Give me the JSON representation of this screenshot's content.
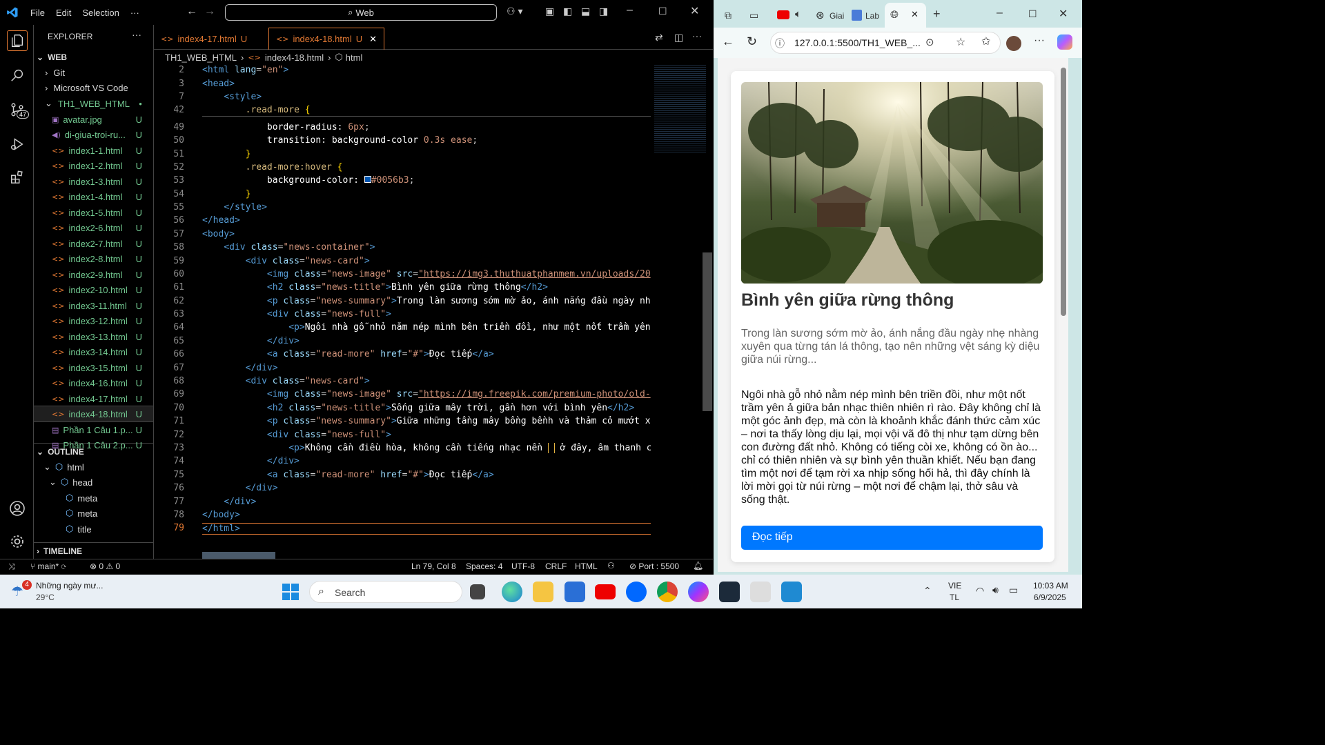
{
  "vscode": {
    "menu": [
      "File",
      "Edit",
      "Selection"
    ],
    "search": "Web",
    "tabs": [
      {
        "label": "index4-17.html",
        "status": "U"
      },
      {
        "label": "index4-18.html",
        "status": "U"
      }
    ],
    "breadcrumb": [
      "TH1_WEB_HTML",
      "index4-18.html",
      "html"
    ],
    "explorer_title": "EXPLORER",
    "section_web": "WEB",
    "folders": [
      "Git",
      "Microsoft VS Code",
      "TH1_WEB_HTML"
    ],
    "files": [
      "avatar.jpg",
      "di-giua-troi-ru...",
      "index1-1.html",
      "index1-2.html",
      "index1-3.html",
      "index1-4.html",
      "index1-5.html",
      "index2-6.html",
      "index2-7.html",
      "index2-8.html",
      "index2-9.html",
      "index2-10.html",
      "index3-11.html",
      "index3-12.html",
      "index3-13.html",
      "index3-14.html",
      "index3-15.html",
      "index4-16.html",
      "index4-17.html",
      "index4-18.html",
      "Phần 1 Câu 1.p...",
      "Phần 1 Câu 2.p..."
    ],
    "file_status": "U",
    "outline_title": "OUTLINE",
    "outline": [
      "html",
      "head",
      "meta",
      "meta",
      "title"
    ],
    "timeline_title": "TIMELINE",
    "scm_badge": "47",
    "line_numbers": [
      "2",
      "3",
      "7",
      "42",
      "49",
      "50",
      "51",
      "52",
      "53",
      "54",
      "55",
      "56",
      "57",
      "58",
      "59",
      "60",
      "61",
      "62",
      "63",
      "64",
      "65",
      "66",
      "67",
      "68",
      "69",
      "70",
      "71",
      "72",
      "73",
      "74",
      "75",
      "76",
      "77",
      "78",
      "79"
    ],
    "status": {
      "branch": "main*",
      "errors": "0",
      "warnings": "0",
      "position": "Ln 79, Col 8",
      "spaces": "Spaces: 4",
      "encoding": "UTF-8",
      "eol": "CRLF",
      "language": "HTML",
      "port": "Port : 5500"
    }
  },
  "browser": {
    "tabs": [
      "Giai",
      "Lab"
    ],
    "url": "127.0.0.1:5500/TH1_WEB_...",
    "page": {
      "title": "Bình yên giữa rừng thông",
      "summary": "Trong làn sương sớm mờ ảo, ánh nắng đầu ngày nhẹ nhàng xuyên qua từng tán lá thông, tạo nên những vệt sáng kỳ diệu giữa núi rừng...",
      "full": "Ngôi nhà gỗ nhỏ nằm nép mình bên triền đồi, như một nốt trầm yên ả giữa bản nhạc thiên nhiên rì rào. Đây không chỉ là một góc ảnh đẹp, mà còn là khoảnh khắc đánh thức cảm xúc – nơi ta thấy lòng dịu lại, mọi vội vã đô thị như tạm dừng bên con đường đất nhỏ. Không có tiếng còi xe, không có ồn ào... chỉ có thiên nhiên và sự bình yên thuần khiết. Nếu bạn đang tìm một nơi để tạm rời xa nhịp sống hối hả, thì đây chính là lời mời gọi từ núi rừng – một nơi để chậm lại, thở sâu và sống thật.",
      "read_more": "Đọc tiếp",
      "button_color": "#0078ff"
    }
  },
  "taskbar": {
    "weather_badge": "4",
    "weather_title": "Những ngày mư...",
    "weather_temp": "29°C",
    "search": "Search",
    "lang": "VIE",
    "lang2": "TL",
    "time": "10:03 AM",
    "date": "6/9/2025"
  }
}
